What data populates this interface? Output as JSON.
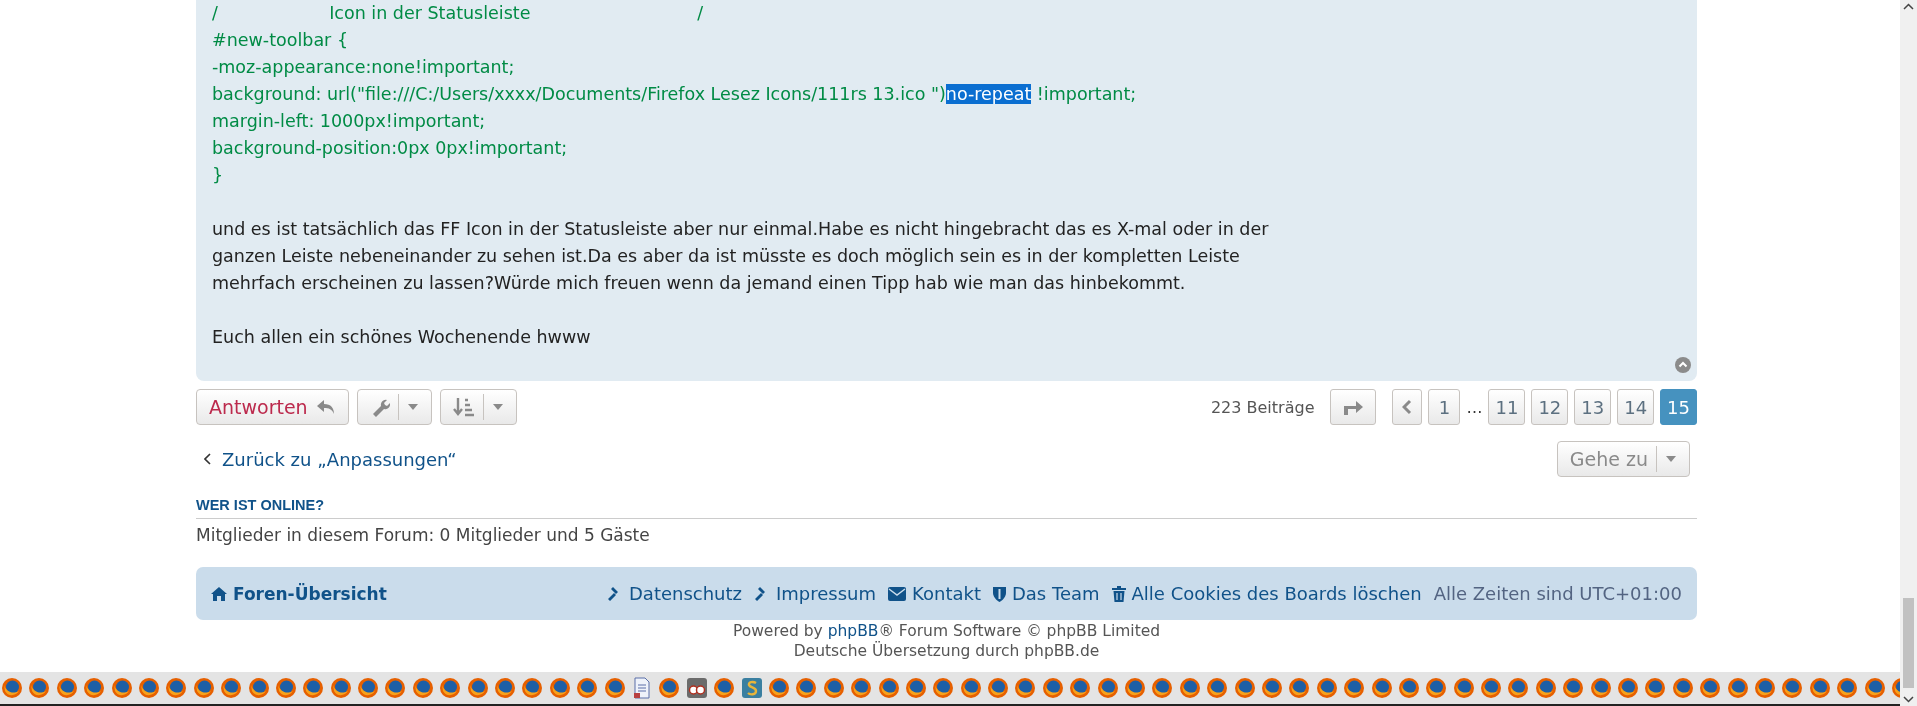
{
  "post": {
    "code_lines": [
      {
        "segments": [
          {
            "text": "/                    Icon in der Statusleiste                              /",
            "highlighted": false
          }
        ]
      },
      {
        "segments": [
          {
            "text": "#new-toolbar {",
            "highlighted": false
          }
        ]
      },
      {
        "segments": [
          {
            "text": "-moz-appearance:none!important;",
            "highlighted": false
          }
        ]
      },
      {
        "segments": [
          {
            "text": "background: url(\"file:///C:/Users/xxxx/Documents/Firefox Lesez Icons/111rs 13.ico \")",
            "highlighted": false
          },
          {
            "text": "no-repeat",
            "highlighted": true
          },
          {
            "text": " !important;",
            "highlighted": false
          }
        ]
      },
      {
        "segments": [
          {
            "text": "margin-left: 1000px!important;",
            "highlighted": false
          }
        ]
      },
      {
        "segments": [
          {
            "text": "background-position:0px 0px!important;",
            "highlighted": false
          }
        ]
      },
      {
        "segments": [
          {
            "text": "}",
            "highlighted": false
          }
        ]
      }
    ],
    "paragraphs": [
      "und es ist tatsächlich das FF Icon in der Statusleiste aber nur einmal.Habe es nicht hingebracht das es X-mal oder in der ganzen Leiste nebeneinander zu sehen ist.Da es aber da ist müsste es doch möglich sein es in der kompletten Leiste mehrfach erscheinen zu lassen?Würde mich freuen wenn da jemand einen Tipp hab wie man das hinbekommt.",
      "Euch allen ein schönes Wochenende hwww"
    ]
  },
  "actions": {
    "reply_button": "Antworten",
    "post_count": "223 Beiträge",
    "pages": [
      {
        "label": "1",
        "kind": "page",
        "selected": false
      },
      {
        "label": "…",
        "kind": "ellipsis",
        "selected": false
      },
      {
        "label": "11",
        "kind": "page",
        "selected": false
      },
      {
        "label": "12",
        "kind": "page",
        "selected": false
      },
      {
        "label": "13",
        "kind": "page",
        "selected": false
      },
      {
        "label": "14",
        "kind": "page",
        "selected": false
      },
      {
        "label": "15",
        "kind": "page",
        "selected": true
      }
    ],
    "back_link": "Zurück zu „Anpassungen“",
    "jump_button": "Gehe zu"
  },
  "online": {
    "heading": "WER IST ONLINE?",
    "text": "Mitglieder in diesem Forum: 0 Mitglieder und 5 Gäste"
  },
  "footer_nav": {
    "home": "Foren-Übersicht",
    "links": [
      "Datenschutz",
      "Impressum",
      "Kontakt",
      "Das Team",
      "Alle Cookies des Boards löschen"
    ],
    "timezone": "Alle Zeiten sind UTC+01:00"
  },
  "credits": {
    "powered_prefix": "Powered by ",
    "powered_link": "phpBB",
    "powered_suffix": "® Forum Software © phpBB Limited",
    "translation": "Deutsche Übersetzung durch phpBB.de"
  }
}
